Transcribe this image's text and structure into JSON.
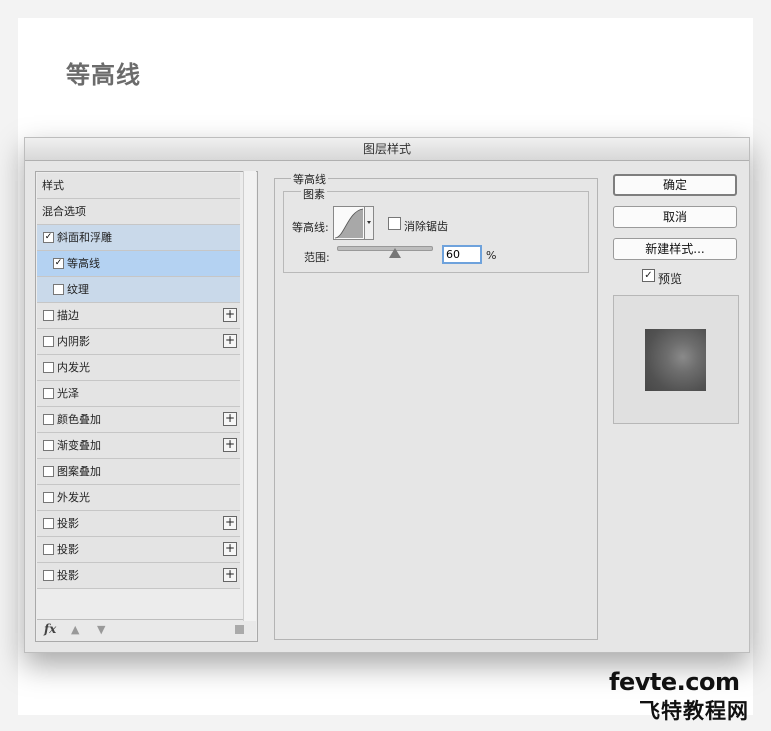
{
  "page": {
    "heading": "等高线"
  },
  "dialog": {
    "title": "图层样式",
    "style_list": {
      "items": [
        {
          "label": "样式",
          "checkbox": false,
          "checked": false,
          "plus": false,
          "state": "normal"
        },
        {
          "label": "混合选项",
          "checkbox": false,
          "checked": false,
          "plus": false,
          "state": "normal"
        },
        {
          "label": "斜面和浮雕",
          "checkbox": true,
          "checked": true,
          "plus": false,
          "state": "parent-highlight"
        },
        {
          "label": "等高线",
          "checkbox": true,
          "checked": true,
          "plus": false,
          "state": "selected"
        },
        {
          "label": "纹理",
          "checkbox": true,
          "checked": false,
          "plus": false,
          "state": "parent-highlight"
        },
        {
          "label": "描边",
          "checkbox": true,
          "checked": false,
          "plus": true,
          "state": "normal"
        },
        {
          "label": "内阴影",
          "checkbox": true,
          "checked": false,
          "plus": true,
          "state": "normal"
        },
        {
          "label": "内发光",
          "checkbox": true,
          "checked": false,
          "plus": false,
          "state": "normal"
        },
        {
          "label": "光泽",
          "checkbox": true,
          "checked": false,
          "plus": false,
          "state": "normal"
        },
        {
          "label": "颜色叠加",
          "checkbox": true,
          "checked": false,
          "plus": true,
          "state": "normal"
        },
        {
          "label": "渐变叠加",
          "checkbox": true,
          "checked": false,
          "plus": true,
          "state": "normal"
        },
        {
          "label": "图案叠加",
          "checkbox": true,
          "checked": false,
          "plus": false,
          "state": "normal"
        },
        {
          "label": "外发光",
          "checkbox": true,
          "checked": false,
          "plus": false,
          "state": "normal"
        },
        {
          "label": "投影",
          "checkbox": true,
          "checked": false,
          "plus": true,
          "state": "normal"
        },
        {
          "label": "投影",
          "checkbox": true,
          "checked": false,
          "plus": true,
          "state": "normal"
        },
        {
          "label": "投影",
          "checkbox": true,
          "checked": false,
          "plus": true,
          "state": "normal"
        }
      ],
      "footer": {
        "fx_label": "fx",
        "up_icon": "arrow-up-icon",
        "down_icon": "arrow-down-icon",
        "trash_icon": "trash-icon"
      }
    },
    "contour_panel": {
      "title": "等高线",
      "elements_title": "图素",
      "contour_label": "等高线:",
      "anti_alias_label": "消除锯齿",
      "anti_alias_checked": false,
      "range_label": "范围:",
      "range_value": "60",
      "range_unit": "%"
    },
    "buttons": {
      "ok": "确定",
      "cancel": "取消",
      "new_style": "新建样式..."
    },
    "preview": {
      "label": "预览",
      "checked": true
    }
  },
  "watermark": {
    "url": "fevte.com",
    "cn": "飞特教程网"
  }
}
